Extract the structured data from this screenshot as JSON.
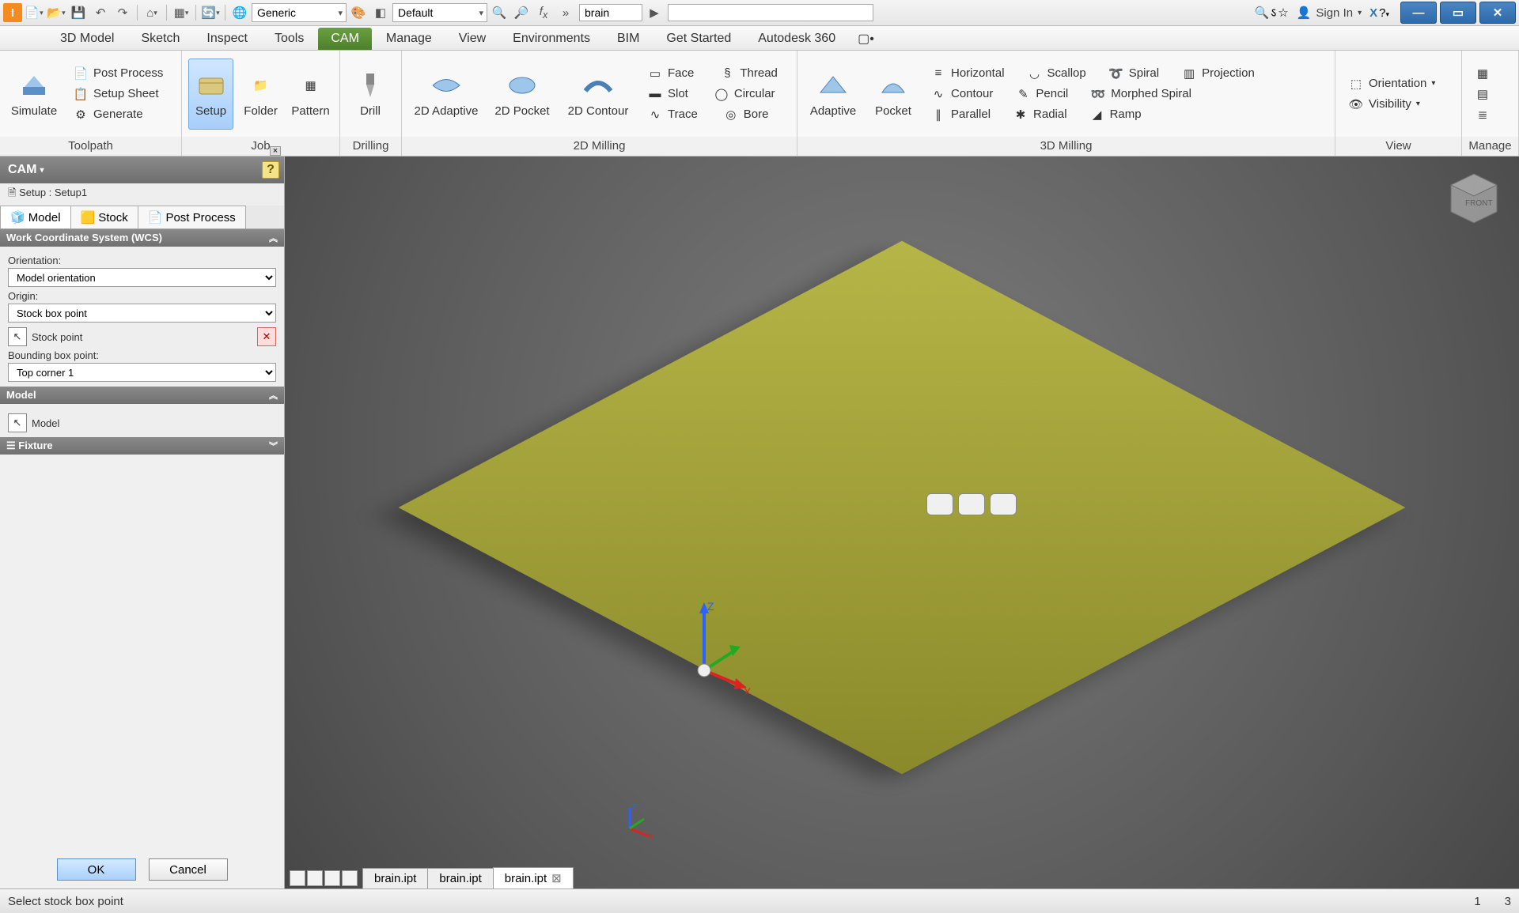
{
  "quick_access": {
    "material_combo": "Generic",
    "appearance_combo": "Default",
    "search_value": "brain"
  },
  "sign_in": "Sign In",
  "menu_tabs": [
    "3D Model",
    "Sketch",
    "Inspect",
    "Tools",
    "CAM",
    "Manage",
    "View",
    "Environments",
    "BIM",
    "Get Started",
    "Autodesk 360"
  ],
  "menu_active": "CAM",
  "ribbon": {
    "groups": {
      "toolpath": {
        "label": "Toolpath",
        "simulate": "Simulate",
        "post_process": "Post Process",
        "setup_sheet": "Setup Sheet",
        "generate": "Generate"
      },
      "job": {
        "label": "Job",
        "setup": "Setup",
        "folder": "Folder",
        "pattern": "Pattern"
      },
      "drilling": {
        "label": "Drilling",
        "drill": "Drill"
      },
      "milling2d": {
        "label": "2D Milling",
        "adaptive": "2D Adaptive",
        "pocket": "2D Pocket",
        "contour": "2D Contour",
        "face": "Face",
        "thread": "Thread",
        "slot": "Slot",
        "circular": "Circular",
        "trace": "Trace",
        "bore": "Bore"
      },
      "milling3d": {
        "label": "3D Milling",
        "adaptive": "Adaptive",
        "pocket": "Pocket",
        "horizontal": "Horizontal",
        "scallop": "Scallop",
        "spiral": "Spiral",
        "projection": "Projection",
        "contour": "Contour",
        "pencil": "Pencil",
        "morphed": "Morphed Spiral",
        "parallel": "Parallel",
        "radial": "Radial",
        "ramp": "Ramp"
      },
      "view": {
        "label": "View",
        "orientation": "Orientation",
        "visibility": "Visibility"
      },
      "manage": {
        "label": "Manage"
      }
    }
  },
  "panel": {
    "title": "CAM",
    "setup_line": "Setup : Setup1",
    "tabs": {
      "model": "Model",
      "stock": "Stock",
      "post": "Post Process"
    },
    "wcs_header": "Work Coordinate System (WCS)",
    "orientation_label": "Orientation:",
    "orientation_value": "Model orientation",
    "origin_label": "Origin:",
    "origin_value": "Stock box point",
    "stock_point_label": "Stock point",
    "bbox_label": "Bounding box point:",
    "bbox_value": "Top corner 1",
    "model_header": "Model",
    "model_item": "Model",
    "fixture_header": "Fixture",
    "ok": "OK",
    "cancel": "Cancel"
  },
  "doc_tabs": [
    "brain.ipt",
    "brain.ipt",
    "brain.ipt"
  ],
  "status": {
    "hint": "Select stock box point",
    "n1": "1",
    "n2": "3"
  }
}
